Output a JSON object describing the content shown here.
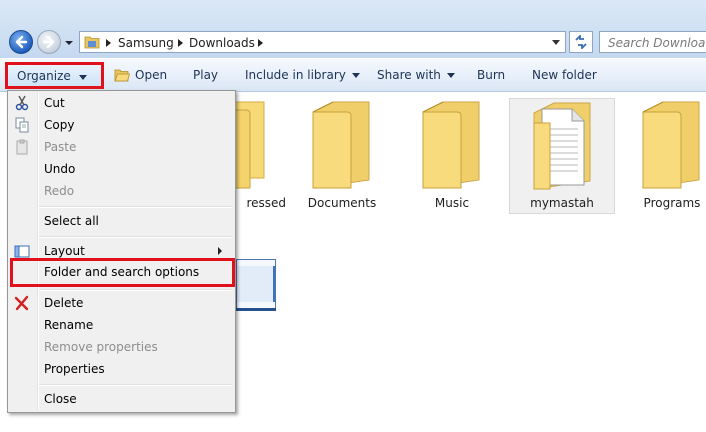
{
  "address_bar": {
    "breadcrumbs": [
      "Samsung",
      "Downloads"
    ],
    "search_placeholder": "Search Downloads"
  },
  "toolbar": {
    "organize": "Organize",
    "open": "Open",
    "play": "Play",
    "include_in_library": "Include in library",
    "share_with": "Share with",
    "burn": "Burn",
    "new_folder": "New folder"
  },
  "folders": [
    {
      "label": "ressed",
      "selected": false
    },
    {
      "label": "Documents",
      "selected": false
    },
    {
      "label": "Music",
      "selected": false
    },
    {
      "label": "mymastah",
      "selected": true
    },
    {
      "label": "Programs",
      "selected": false
    }
  ],
  "menu": {
    "items": [
      {
        "label": "Cut",
        "icon": "scissors-icon",
        "enabled": true
      },
      {
        "label": "Copy",
        "icon": "copy-icon",
        "enabled": true
      },
      {
        "label": "Paste",
        "icon": "paste-icon",
        "enabled": false
      },
      {
        "label": "Undo",
        "enabled": true
      },
      {
        "label": "Redo",
        "enabled": false
      },
      {
        "label": "Select all",
        "enabled": true
      },
      {
        "label": "Layout",
        "icon": "layout-icon",
        "enabled": true,
        "submenu": true
      },
      {
        "label": "Folder and search options",
        "enabled": true,
        "highlighted": true
      },
      {
        "label": "Delete",
        "icon": "delete-x-icon",
        "enabled": true
      },
      {
        "label": "Rename",
        "enabled": true
      },
      {
        "label": "Remove properties",
        "enabled": false
      },
      {
        "label": "Properties",
        "enabled": true
      },
      {
        "label": "Close",
        "enabled": true
      }
    ]
  },
  "colors": {
    "highlight_box": "#e0111a",
    "folder_body": "#f7d978",
    "command_text": "#1e3355"
  }
}
